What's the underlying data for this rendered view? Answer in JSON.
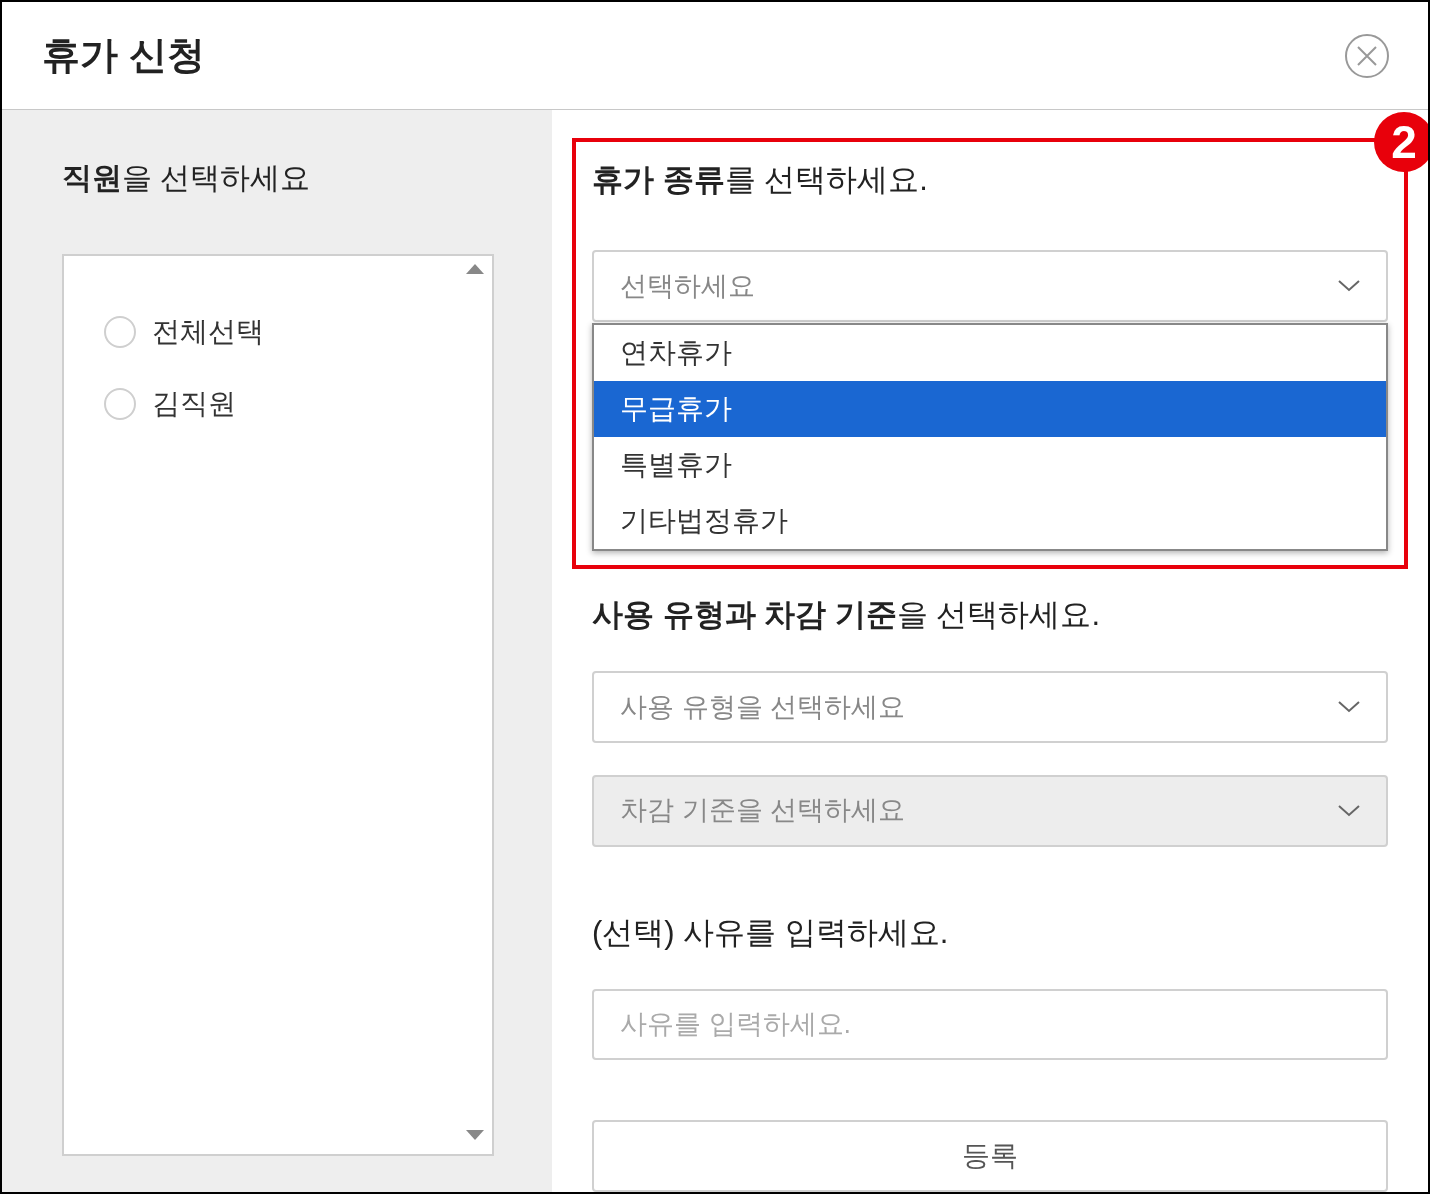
{
  "dialog": {
    "title": "휴가 신청"
  },
  "employees": {
    "heading": "**직원**을 선택하세요",
    "items": [
      {
        "label": "전체선택",
        "selected": false
      },
      {
        "label": "김직원",
        "selected": false
      }
    ]
  },
  "annotation": {
    "badge": "2"
  },
  "leave_type": {
    "heading": "**휴가 종류**를 선택하세요.",
    "select": {
      "placeholder": "선택하세요",
      "expanded": true
    },
    "options": [
      {
        "label": "연차휴가",
        "selected": false
      },
      {
        "label": "무급휴가",
        "selected": true
      },
      {
        "label": "특별휴가",
        "selected": false
      },
      {
        "label": "기타법정휴가",
        "selected": false
      }
    ]
  },
  "usage": {
    "heading": "**사용 유형과 차감 기준**을 선택하세요.",
    "selects": [
      {
        "placeholder": "사용 유형을 선택하세요",
        "disabled": false
      },
      {
        "placeholder": "차감 기준을 선택하세요",
        "disabled": true
      }
    ]
  },
  "reason": {
    "heading": "(선택) 사유를 입력하세요.",
    "placeholder": "사유를 입력하세요."
  },
  "submit": {
    "label": "등록"
  }
}
